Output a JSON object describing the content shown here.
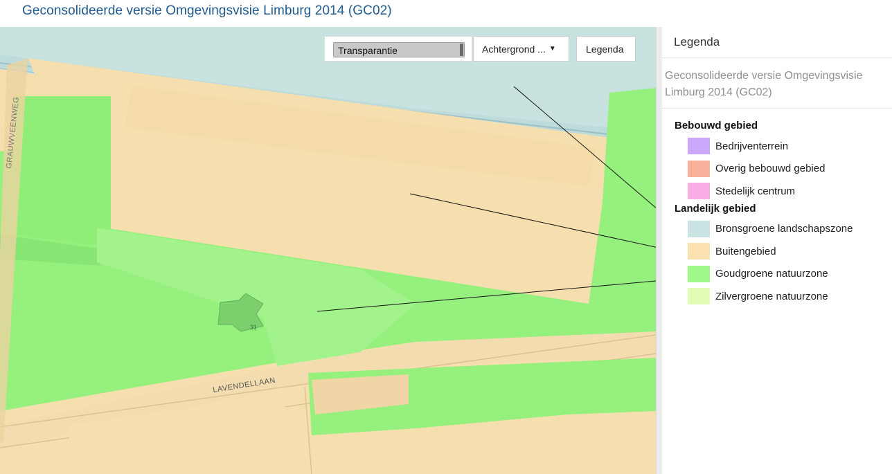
{
  "header": {
    "title": "Geconsolideerde versie Omgevingsvisie Limburg 2014 (GC02)"
  },
  "map": {
    "street_labels": {
      "grauwveenweg": "GRAUWVEENWEG",
      "lavendellaan": "LAVENDELLAAN",
      "house_number": "31"
    },
    "controls": {
      "transparency_label": "Transparantie",
      "background_label": "Achtergrond ...",
      "legend_button_label": "Legenda"
    }
  },
  "legend": {
    "header": "Legenda",
    "subtitle": "Geconsolideerde versie Omgevingsvisie Limburg 2014 (GC02)",
    "groups": [
      {
        "title": "Bebouwd gebied",
        "items": [
          {
            "label": "Bedrijventerrein",
            "color": "#cba8fa"
          },
          {
            "label": "Overig bebouwd gebied",
            "color": "#f9b09a"
          },
          {
            "label": "Stedelijk centrum",
            "color": "#f9aee6"
          }
        ]
      },
      {
        "title": "Landelijk gebied",
        "items": [
          {
            "label": "Bronsgroene landschapszone",
            "color": "#c9e3e3"
          },
          {
            "label": "Buitengebied",
            "color": "#fbe0b0"
          },
          {
            "label": "Goudgroene natuurzone",
            "color": "#9ef98a"
          },
          {
            "label": "Zilvergroene natuurzone",
            "color": "#e2fcb6"
          }
        ]
      }
    ]
  },
  "colors": {
    "title_blue": "#1f5a8f",
    "buitengebied": "#f6dfae",
    "goudgroen": "#95f07e",
    "bronsgroen": "#c8e2df",
    "zilvergroen": "#e0f9b0"
  }
}
